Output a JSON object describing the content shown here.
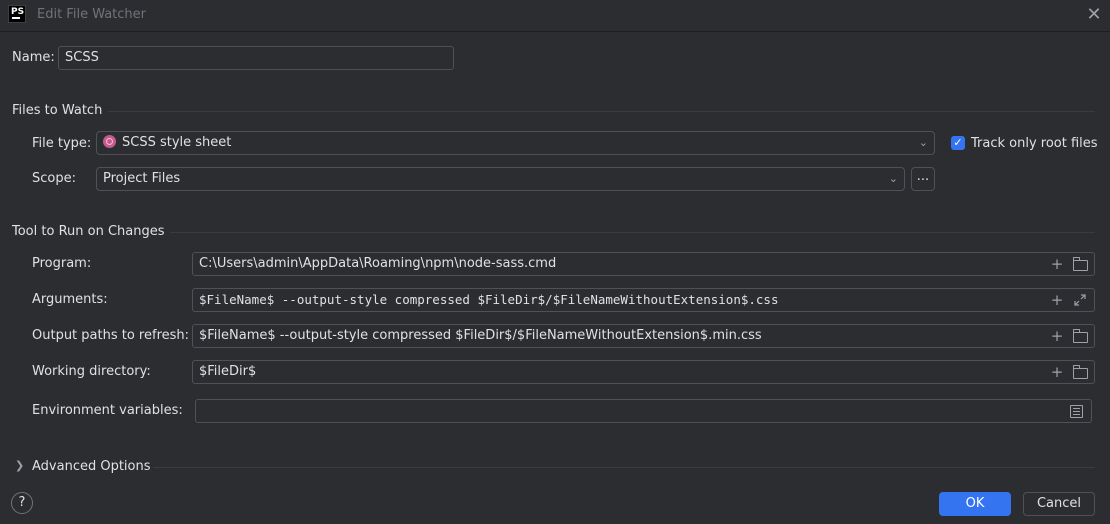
{
  "window": {
    "title": "Edit File Watcher",
    "app_icon_text": "PS",
    "close_glyph": "✕"
  },
  "name": {
    "label": "Name:",
    "value": "SCSS"
  },
  "files_to_watch": {
    "heading": "Files to Watch",
    "file_type_label": "File type:",
    "file_type_value": "SCSS style sheet",
    "file_type_icon": "scss-icon",
    "track_root_label": "Track only root files",
    "track_root_checked": true,
    "scope_label": "Scope:",
    "scope_value": "Project Files",
    "scope_more": "..."
  },
  "tool": {
    "heading": "Tool to Run on Changes",
    "program_label": "Program:",
    "program_value": "C:\\Users\\admin\\AppData\\Roaming\\npm\\node-sass.cmd",
    "arguments_label": "Arguments:",
    "arguments_value": "$FileName$ --output-style compressed $FileDir$/$FileNameWithoutExtension$.css",
    "output_label": "Output paths to refresh:",
    "output_value": "$FileName$ --output-style compressed $FileDir$/$FileNameWithoutExtension$.min.css",
    "workdir_label": "Working directory:",
    "workdir_value": "$FileDir$",
    "env_label": "Environment variables:",
    "env_value": ""
  },
  "advanced": {
    "label": "Advanced Options",
    "expanded": false
  },
  "footer": {
    "help_glyph": "?",
    "ok_label": "OK",
    "cancel_label": "Cancel"
  },
  "colors": {
    "background": "#2b2d30",
    "accent": "#3574f0",
    "border": "#4e5157",
    "text": "#dfe1e5"
  }
}
